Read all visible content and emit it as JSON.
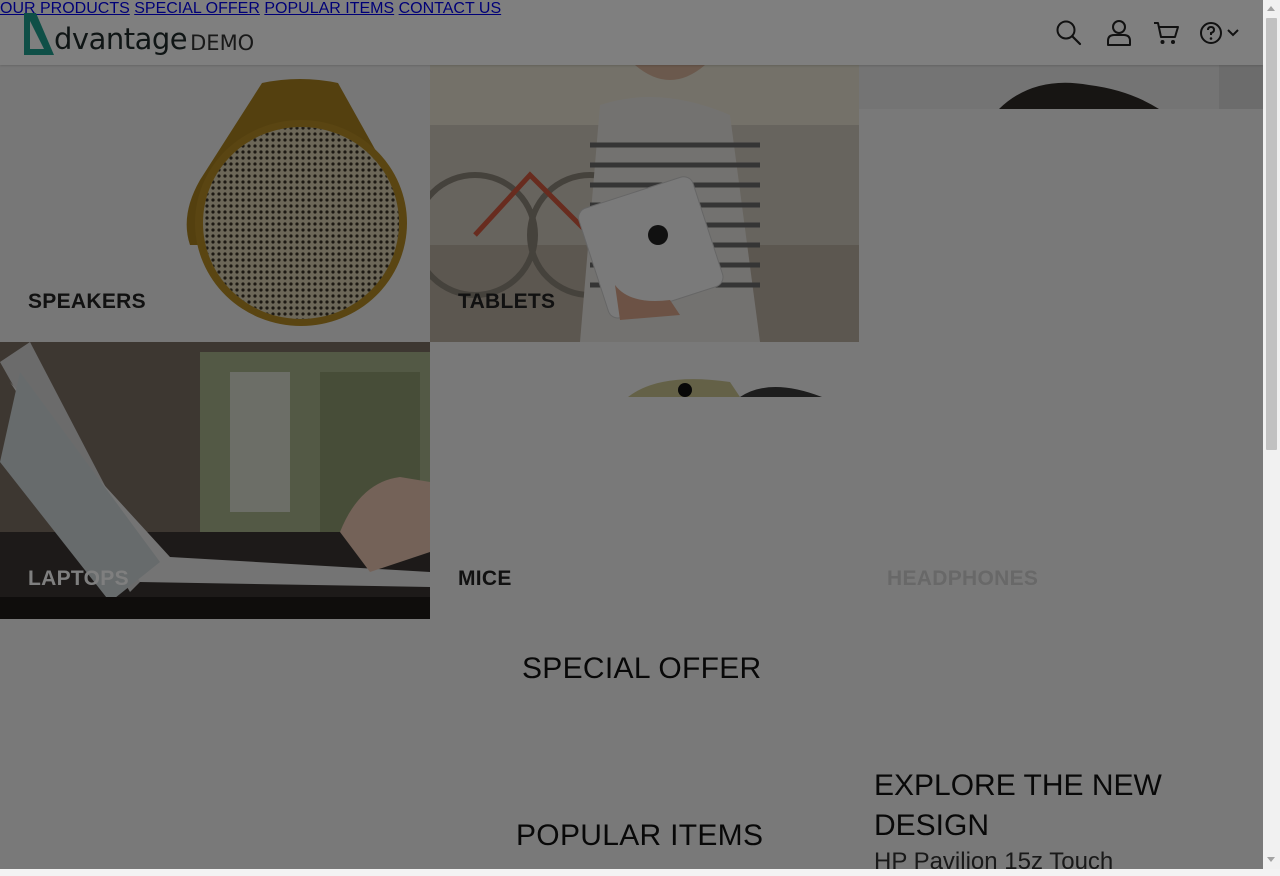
{
  "header": {
    "logo_word": "dvantage",
    "logo_demo": "DEMO",
    "nav": {
      "our_products": "OUR PRODUCTS",
      "special_offer": "SPECIAL OFFER",
      "popular_items": "POPULAR ITEMS",
      "contact_us": "CONTACT US"
    },
    "icons": [
      "search-icon",
      "user-icon",
      "cart-icon",
      "help-icon",
      "chevron-down-icon"
    ]
  },
  "categories": {
    "speakers": "SPEAKERS",
    "tablets": "TABLETS",
    "laptops": "LAPTOPS",
    "mice": "MICE",
    "headphones": "HEADPHONES"
  },
  "sections": {
    "special_offer": "SPECIAL OFFER",
    "popular_items": "POPULAR ITEMS",
    "explore_title": "EXPLORE THE NEW DESIGN",
    "explore_sub": "HP Pavilion 15z Touch"
  },
  "colors": {
    "brand_teal": "#1f9e8e",
    "overlay": "rgba(0,0,0,0.5)"
  }
}
